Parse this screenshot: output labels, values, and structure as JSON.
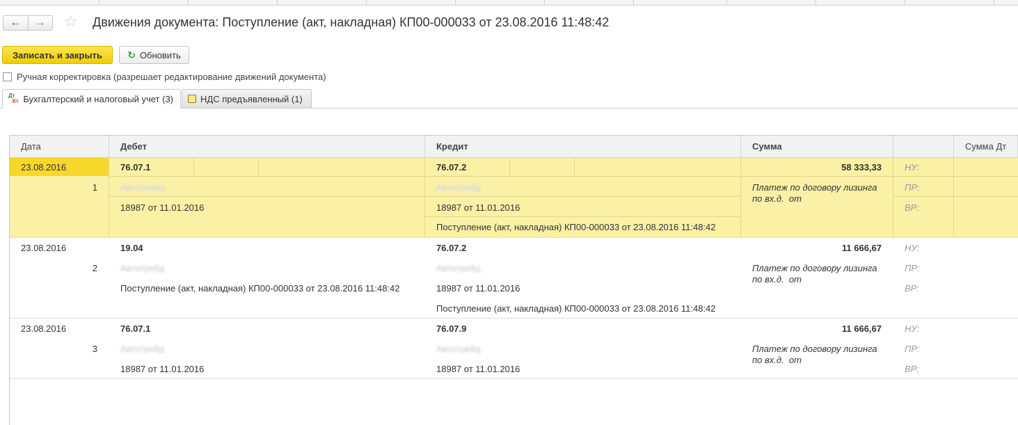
{
  "window": {
    "title": "Движения документа: Поступление (акт, накладная) КП00-000033 от 23.08.2016 11:48:42",
    "nav_back_icon": "arrow-left-icon",
    "nav_forward_icon": "arrow-right-icon",
    "favorite_icon": "star-icon"
  },
  "toolbar": {
    "save_close_label": "Записать и закрыть",
    "refresh_label": "Обновить"
  },
  "manual_adjust": {
    "label": "Ручная корректировка (разрешает редактирование движений документа)",
    "checked": false
  },
  "tabs": [
    {
      "label": "Бухгалтерский и налоговый учет (3)",
      "active": true
    },
    {
      "label": "НДС предъявленный (1)",
      "active": false
    }
  ],
  "table": {
    "columns": {
      "date": "Дата",
      "debit": "Дебет",
      "credit": "Кредит",
      "amount": "Сумма",
      "amount_dt": "Сумма Дт"
    },
    "rows": [
      {
        "date": "23.08.2016",
        "num": "1",
        "debit_account": "76.07.1",
        "debit_sub1": "Автотрейд",
        "debit_sub2": "18987 от 11.01.2016",
        "credit_account": "76.07.2",
        "credit_sub1": "Автотрейд",
        "credit_sub2": "18987 от 11.01.2016",
        "credit_sub3": "Поступление (акт, накладная) КП00-000033 от 23.08.2016 11:48:42",
        "amount": "58 333,33",
        "content_line1": "Платеж по договору лизинга",
        "content_line2": "по вх.д.  от",
        "nu": "НУ:",
        "pr": "ПР:",
        "vr": "ВР:"
      },
      {
        "date": "23.08.2016",
        "num": "2",
        "debit_account": "19.04",
        "debit_sub1": "Автотрейд",
        "debit_sub2": "Поступление (акт, накладная) КП00-000033 от 23.08.2016 11:48:42",
        "credit_account": "76.07.2",
        "credit_sub1": "Автотрейд",
        "credit_sub2": "18987 от 11.01.2016",
        "credit_sub3": "Поступление (акт, накладная) КП00-000033 от 23.08.2016 11:48:42",
        "amount": "11 666,67",
        "content_line1": "Платеж по договору лизинга",
        "content_line2": "по вх.д.  от",
        "nu": "НУ:",
        "pr": "ПР:",
        "vr": "ВР:"
      },
      {
        "date": "23.08.2016",
        "num": "3",
        "debit_account": "76.07.1",
        "debit_sub1": "Автотрейд",
        "debit_sub2": "18987 от 11.01.2016",
        "credit_account": "76.07.9",
        "credit_sub1": "Автотрейд",
        "credit_sub2": "18987 от 11.01.2016",
        "amount": "11 666,67",
        "content_line1": "Платеж по договору лизинга",
        "content_line2": "по вх.д.  от",
        "nu": "НУ:",
        "pr": "ПР:",
        "vr": "ВР:"
      }
    ]
  },
  "colors": {
    "primary_button": "#f2cd00",
    "selected_row": "#faf0a6",
    "selected_cell": "#f7d72c"
  }
}
